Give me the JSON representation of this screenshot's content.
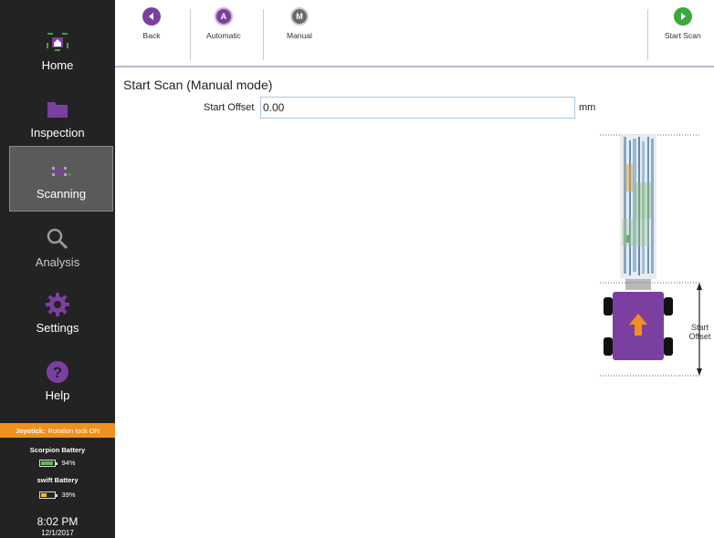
{
  "sidebar": {
    "items": [
      {
        "label": "Home",
        "icon": "home-icon"
      },
      {
        "label": "Inspection",
        "icon": "folder-icon"
      },
      {
        "label": "Scanning",
        "icon": "scanner-icon",
        "active": true
      },
      {
        "label": "Analysis",
        "icon": "magnifier-icon"
      },
      {
        "label": "Settings",
        "icon": "gear-icon"
      },
      {
        "label": "Help",
        "icon": "help-icon"
      }
    ],
    "joystick": {
      "label": "Joystick:",
      "status": "Rotation lock ON"
    },
    "batteries": [
      {
        "title": "Scorpion Battery",
        "percent_text": "94%",
        "level": 0.94,
        "color": "#5bbf3a"
      },
      {
        "title": "swift Battery",
        "percent_text": "39%",
        "level": 0.39,
        "color": "#f2c200"
      }
    ],
    "clock": {
      "time": "8:02 PM",
      "date": "12/1/2017"
    }
  },
  "toolbar": {
    "back": {
      "label": "Back",
      "icon": "back-arrow-icon"
    },
    "automatic": {
      "label": "Automatic",
      "icon": "automatic-mode-icon",
      "glyph": "A"
    },
    "manual": {
      "label": "Manual",
      "icon": "manual-mode-icon",
      "glyph": "M"
    },
    "start_scan": {
      "label": "Start Scan",
      "icon": "play-icon"
    }
  },
  "main": {
    "title": "Start Scan (Manual mode)",
    "start_offset": {
      "label": "Start Offset",
      "value": "0.00",
      "unit": "mm"
    },
    "diagram": {
      "offset_line1": "Start",
      "offset_line2": "Offset"
    }
  },
  "colors": {
    "accent_purple": "#7b3fa0",
    "play_green": "#3aa83a",
    "orange": "#f0901e",
    "sidebar_bg": "#232323"
  }
}
